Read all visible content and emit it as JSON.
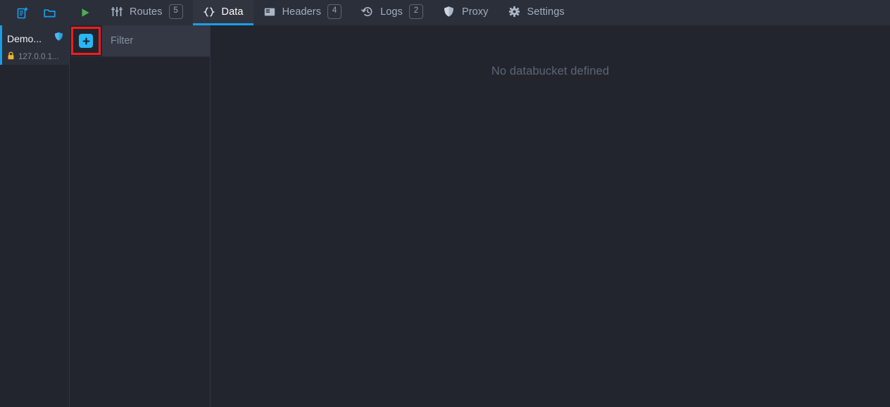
{
  "topbar": {
    "left_icons": [
      {
        "name": "new-environment-icon",
        "label": "New environment"
      },
      {
        "name": "open-environment-icon",
        "label": "Open environment"
      }
    ],
    "play_button": {
      "name": "start-server-button",
      "label": "Start server",
      "color": "#4caf50"
    },
    "tabs": [
      {
        "id": "routes",
        "label": "Routes",
        "icon": "sliders-icon",
        "badge": "5",
        "active": false
      },
      {
        "id": "data",
        "label": "Data",
        "icon": "braces-icon",
        "badge": "",
        "active": true
      },
      {
        "id": "headers",
        "label": "Headers",
        "icon": "headers-icon",
        "badge": "4",
        "active": false
      },
      {
        "id": "logs",
        "label": "Logs",
        "icon": "history-icon",
        "badge": "2",
        "active": false
      },
      {
        "id": "proxy",
        "label": "Proxy",
        "icon": "shield-icon",
        "badge": "",
        "active": false
      },
      {
        "id": "settings",
        "label": "Settings",
        "icon": "gear-icon",
        "badge": "",
        "active": false
      }
    ]
  },
  "environments": [
    {
      "name": "Demo...",
      "url": "127.0.0.1...",
      "status_icon": "shield-icon",
      "lock_icon": "lock-icon",
      "active": true
    }
  ],
  "databuckets": {
    "add_button": {
      "name": "add-databucket-button",
      "label": "+"
    },
    "filter": {
      "value": "",
      "placeholder": "Filter"
    },
    "items": []
  },
  "main": {
    "empty_message": "No databucket defined"
  },
  "colors": {
    "accent": "#1a9ee8",
    "add_button": "#29b6f6",
    "highlight": "#f51b1b",
    "play": "#4caf50",
    "lock": "#e8b52c"
  }
}
